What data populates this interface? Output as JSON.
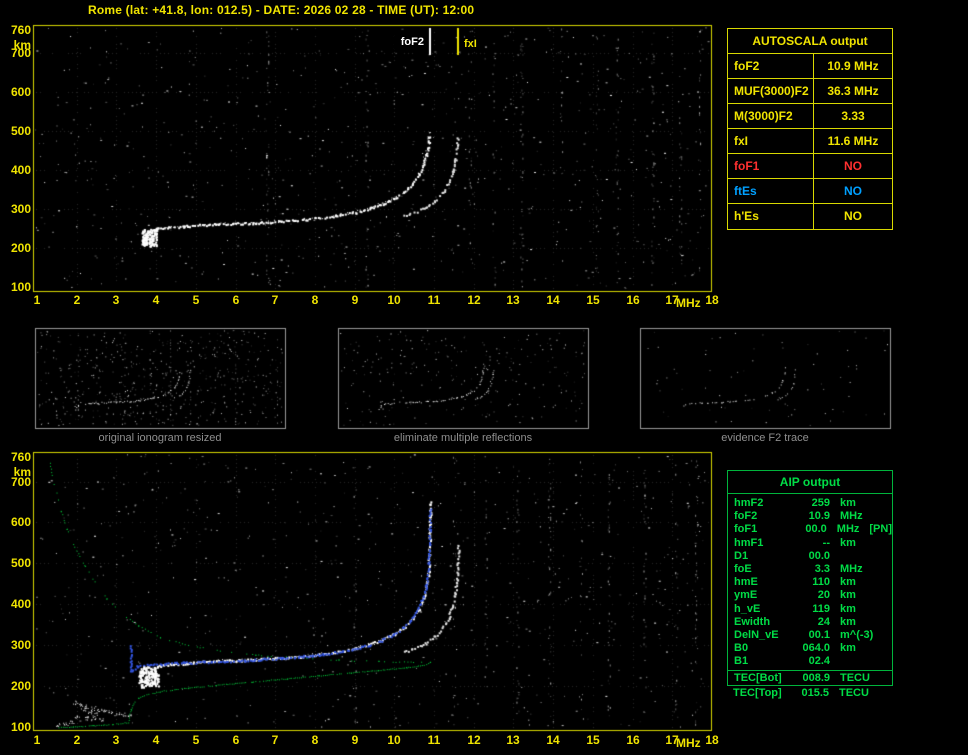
{
  "header": {
    "title": "Rome (lat: +41.8, lon: 012.5) - DATE: 2026 02 28 - TIME (UT): 12:00"
  },
  "colors": {
    "axis_yellow": "#f0e400",
    "border_yellow": "#d8d800",
    "green": "#00d23c",
    "trace_white": "#ffffff",
    "fit_blue": "#3355e0",
    "value_red": "#ff3030",
    "value_blue": "#00a0ff",
    "caption_gray": "#8f8f8f"
  },
  "autoscala": {
    "title": "AUTOSCALA output",
    "rows": [
      {
        "label": "foF2",
        "value": "10.9 MHz",
        "color": "yellow"
      },
      {
        "label": "MUF(3000)F2",
        "value": "36.3 MHz",
        "color": "yellow"
      },
      {
        "label": "M(3000)F2",
        "value": "3.33",
        "color": "yellow"
      },
      {
        "label": "fxI",
        "value": "11.6 MHz",
        "color": "yellow"
      },
      {
        "label": "foF1",
        "value": "NO",
        "color": "red"
      },
      {
        "label": "ftEs",
        "value": "NO",
        "color": "blue"
      },
      {
        "label": "h'Es",
        "value": "NO",
        "color": "yellow"
      }
    ]
  },
  "aip": {
    "title": "AIP output",
    "rows": [
      {
        "label": "hmF2",
        "value": "259",
        "unit": "km"
      },
      {
        "label": "foF2",
        "value": "10.9",
        "unit": "MHz"
      },
      {
        "label": "foF1",
        "value": "00.0",
        "unit": "MHz",
        "note": "[PN]"
      },
      {
        "label": "hmF1",
        "value": "--",
        "unit": "km"
      },
      {
        "label": "D1",
        "value": "00.0",
        "unit": ""
      },
      {
        "label": "foE",
        "value": "3.3",
        "unit": "MHz"
      },
      {
        "label": "hmE",
        "value": "110",
        "unit": "km"
      },
      {
        "label": "ymE",
        "value": "20",
        "unit": "km"
      },
      {
        "label": "h_vE",
        "value": "119",
        "unit": "km"
      },
      {
        "label": "Ewidth",
        "value": "24",
        "unit": "km"
      },
      {
        "label": "DelN_vE",
        "value": "00.1",
        "unit": "m^(-3)"
      },
      {
        "label": "B0",
        "value": "064.0",
        "unit": "km"
      },
      {
        "label": "B1",
        "value": "02.4",
        "unit": ""
      }
    ],
    "tec_rows": [
      {
        "label": "TEC[Bot]",
        "value": "008.9",
        "unit": "TECU"
      },
      {
        "label": "TEC[Top]",
        "value": "015.5",
        "unit": "TECU"
      }
    ]
  },
  "thumbnails": [
    {
      "caption": "original ionogram resized"
    },
    {
      "caption": "eliminate multiple reflections"
    },
    {
      "caption": "evidence F2 trace"
    }
  ],
  "chart_data": [
    {
      "id": "top_ionogram",
      "type": "scatter",
      "title": "recorded ionogram",
      "xlabel": "MHz",
      "ylabel": "km",
      "xlim": [
        1,
        18
      ],
      "ylim": [
        100,
        760
      ],
      "grid": true,
      "x_ticks": [
        1,
        2,
        3,
        4,
        5,
        6,
        7,
        8,
        9,
        10,
        11,
        12,
        13,
        14,
        15,
        16,
        17,
        18
      ],
      "y_ticks": [
        760,
        700,
        600,
        500,
        400,
        300,
        200,
        100
      ],
      "markers": [
        {
          "label": "foF2",
          "freq_mhz": 10.9,
          "color": "#ffffff"
        },
        {
          "label": "fxI",
          "freq_mhz": 11.6,
          "color": "#f0e400"
        }
      ],
      "blob": {
        "f": [
          3.62,
          4.02
        ],
        "km": [
          205,
          250
        ]
      },
      "series": [
        {
          "name": "O-mode trace",
          "color": "#ffffff",
          "points": [
            [
              3.68,
              212
            ],
            [
              3.76,
              230
            ],
            [
              3.86,
              243
            ],
            [
              4.0,
              250
            ],
            [
              4.3,
              254
            ],
            [
              4.7,
              257
            ],
            [
              5.1,
              260
            ],
            [
              5.5,
              262
            ],
            [
              6.0,
              264
            ],
            [
              6.5,
              266
            ],
            [
              7.0,
              269
            ],
            [
              7.5,
              272
            ],
            [
              8.0,
              277
            ],
            [
              8.5,
              284
            ],
            [
              9.0,
              293
            ],
            [
              9.35,
              303
            ],
            [
              9.7,
              315
            ],
            [
              10.0,
              329
            ],
            [
              10.25,
              346
            ],
            [
              10.45,
              366
            ],
            [
              10.6,
              389
            ],
            [
              10.72,
              415
            ],
            [
              10.8,
              443
            ],
            [
              10.85,
              472
            ],
            [
              10.88,
              500
            ]
          ]
        },
        {
          "name": "X-mode trace",
          "color": "#e0e0e0",
          "points": [
            [
              10.2,
              283
            ],
            [
              10.5,
              293
            ],
            [
              10.78,
              306
            ],
            [
              11.0,
              322
            ],
            [
              11.2,
              343
            ],
            [
              11.35,
              368
            ],
            [
              11.45,
              396
            ],
            [
              11.52,
              428
            ],
            [
              11.56,
              458
            ],
            [
              11.585,
              485
            ]
          ]
        }
      ]
    },
    {
      "id": "bottom_ionogram",
      "type": "scatter",
      "title": "scaled ionogram with restored trace and electron density profile",
      "xlabel": "MHz",
      "ylabel": "km",
      "xlim": [
        1,
        18
      ],
      "ylim": [
        100,
        760
      ],
      "grid": true,
      "x_ticks": [
        1,
        2,
        3,
        4,
        5,
        6,
        7,
        8,
        9,
        10,
        11,
        12,
        13,
        14,
        15,
        16,
        17,
        18
      ],
      "y_ticks": [
        760,
        700,
        600,
        500,
        400,
        300,
        200,
        100
      ],
      "blob": {
        "f": [
          3.55,
          4.05
        ],
        "km": [
          198,
          248
        ]
      },
      "series": [
        {
          "name": "O-mode trace",
          "color": "#ffffff",
          "points": [
            [
              3.68,
              210
            ],
            [
              3.78,
              228
            ],
            [
              3.9,
              242
            ],
            [
              4.05,
              250
            ],
            [
              4.35,
              254
            ],
            [
              4.75,
              257
            ],
            [
              5.15,
              260
            ],
            [
              5.55,
              262
            ],
            [
              6.0,
              264
            ],
            [
              6.5,
              266
            ],
            [
              7.0,
              269
            ],
            [
              7.5,
              272
            ],
            [
              8.0,
              277
            ],
            [
              8.5,
              284
            ],
            [
              9.0,
              293
            ],
            [
              9.35,
              303
            ],
            [
              9.7,
              315
            ],
            [
              10.0,
              329
            ],
            [
              10.25,
              346
            ],
            [
              10.45,
              366
            ],
            [
              10.6,
              389
            ],
            [
              10.72,
              415
            ],
            [
              10.8,
              445
            ],
            [
              10.85,
              480
            ],
            [
              10.87,
              520
            ],
            [
              10.882,
              565
            ],
            [
              10.89,
              615
            ],
            [
              10.893,
              652
            ]
          ]
        },
        {
          "name": "X-mode trace",
          "color": "#e0e0e0",
          "points": [
            [
              10.2,
              283
            ],
            [
              10.5,
              293
            ],
            [
              10.78,
              306
            ],
            [
              11.0,
              322
            ],
            [
              11.2,
              343
            ],
            [
              11.35,
              368
            ],
            [
              11.45,
              396
            ],
            [
              11.52,
              428
            ],
            [
              11.56,
              462
            ],
            [
              11.585,
              502
            ],
            [
              11.6,
              545
            ]
          ]
        },
        {
          "name": "fitted trace",
          "color": "#3355e0",
          "points": [
            [
              3.36,
              300
            ],
            [
              3.36,
              236
            ],
            [
              3.5,
              249
            ],
            [
              3.8,
              253
            ],
            [
              4.2,
              256
            ],
            [
              4.7,
              258
            ],
            [
              5.2,
              260
            ],
            [
              5.7,
              262
            ],
            [
              6.2,
              264
            ],
            [
              6.7,
              267
            ],
            [
              7.2,
              270
            ],
            [
              7.7,
              274
            ],
            [
              8.2,
              279
            ],
            [
              8.7,
              287
            ],
            [
              9.2,
              297
            ],
            [
              9.6,
              310
            ],
            [
              9.95,
              326
            ],
            [
              10.2,
              343
            ],
            [
              10.4,
              362
            ],
            [
              10.57,
              386
            ],
            [
              10.7,
              414
            ],
            [
              10.79,
              448
            ],
            [
              10.84,
              488
            ],
            [
              10.87,
              535
            ],
            [
              10.885,
              588
            ],
            [
              10.89,
              638
            ]
          ]
        },
        {
          "name": "N(h) profile topside",
          "color": "#00d23c",
          "points": [
            [
              1.3,
              755
            ],
            [
              1.38,
              715
            ],
            [
              1.48,
              672
            ],
            [
              1.6,
              628
            ],
            [
              1.75,
              585
            ],
            [
              1.95,
              540
            ],
            [
              2.2,
              495
            ],
            [
              2.45,
              455
            ],
            [
              2.75,
              415
            ],
            [
              3.1,
              380
            ],
            [
              3.55,
              348
            ],
            [
              4.1,
              320
            ],
            [
              4.8,
              300
            ],
            [
              5.6,
              287
            ],
            [
              6.5,
              277
            ],
            [
              7.5,
              270
            ],
            [
              8.6,
              264
            ],
            [
              9.6,
              261
            ],
            [
              10.4,
              259.5
            ],
            [
              10.9,
              259
            ]
          ]
        },
        {
          "name": "N(h) profile bottomside",
          "color": "#00d23c",
          "points": [
            [
              10.9,
              259
            ],
            [
              10.75,
              252
            ],
            [
              10.3,
              246
            ],
            [
              9.6,
              239
            ],
            [
              8.9,
              233
            ],
            [
              8.1,
              226
            ],
            [
              7.3,
              219
            ],
            [
              6.4,
              211
            ],
            [
              5.5,
              203
            ],
            [
              4.8,
              196
            ],
            [
              4.2,
              189
            ],
            [
              3.8,
              181
            ],
            [
              3.55,
              171
            ],
            [
              3.42,
              158
            ],
            [
              3.36,
              143
            ],
            [
              3.32,
              128
            ],
            [
              3.3,
              112
            ],
            [
              2.9,
              107
            ],
            [
              2.4,
              104
            ],
            [
              1.9,
              101
            ],
            [
              1.55,
              100
            ]
          ]
        },
        {
          "name": "E-region echoes",
          "color": "#e8e8e8",
          "points": [
            [
              1.95,
              160
            ],
            [
              2.1,
              155
            ],
            [
              2.25,
              150
            ],
            [
              2.4,
              146
            ],
            [
              2.55,
              142
            ],
            [
              2.7,
              139
            ],
            [
              2.85,
              136
            ],
            [
              3.0,
              133
            ],
            [
              3.15,
              131
            ],
            [
              3.3,
              129
            ],
            [
              2.0,
              126
            ],
            [
              2.2,
              123
            ],
            [
              2.4,
              120
            ],
            [
              2.6,
              117
            ],
            [
              1.5,
              105
            ],
            [
              1.7,
              109
            ],
            [
              1.85,
              113
            ],
            [
              2.3,
              135
            ],
            [
              2.45,
              131
            ],
            [
              2.15,
              143
            ]
          ]
        }
      ]
    }
  ]
}
